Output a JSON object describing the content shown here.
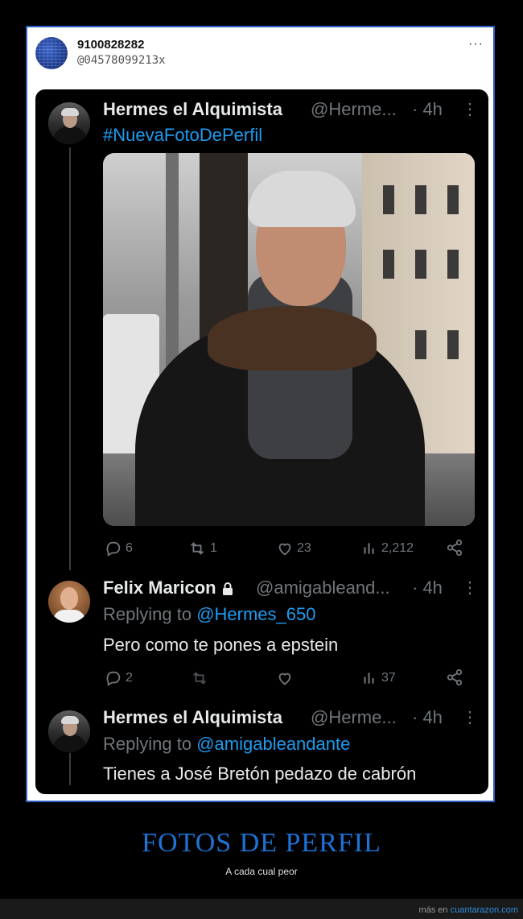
{
  "outer_post": {
    "name": "9100828282",
    "handle": "@04578099213x",
    "more": "···"
  },
  "tweets": [
    {
      "name": "Hermes el Alquimista",
      "handle": "@Herme...",
      "time": "· 4h",
      "text": "#NuevaFotoDePerfil",
      "actions": {
        "replies": "6",
        "retweets": "1",
        "likes": "23",
        "views": "2,212"
      }
    },
    {
      "name": "Felix Maricon",
      "handle": "@amigableand...",
      "time": "· 4h",
      "replying_label": "Replying to",
      "replying_to": "@Hermes_650",
      "text": "Pero como te pones a epstein",
      "actions": {
        "replies": "2",
        "retweets": "",
        "likes": "",
        "views": "37"
      }
    },
    {
      "name": "Hermes el Alquimista",
      "handle": "@Herme...",
      "time": "· 4h",
      "replying_label": "Replying to",
      "replying_to": "@amigableandante",
      "text": "Tienes a José Bretón pedazo de cabrón"
    }
  ],
  "footer": {
    "title": "FOTOS DE PERFIL",
    "subtitle": "A cada cual peor",
    "credit_prefix": "más en",
    "credit_site": "cuantarazon.com"
  },
  "colors": {
    "accent": "#1d9bf0",
    "frame_border": "#2f5fc4",
    "footer_title": "#1d72d6",
    "muted": "#71767b"
  },
  "icons": [
    "more-icon",
    "kebab-icon",
    "lock-icon",
    "reply-icon",
    "retweet-icon",
    "like-icon",
    "views-icon",
    "share-icon"
  ]
}
